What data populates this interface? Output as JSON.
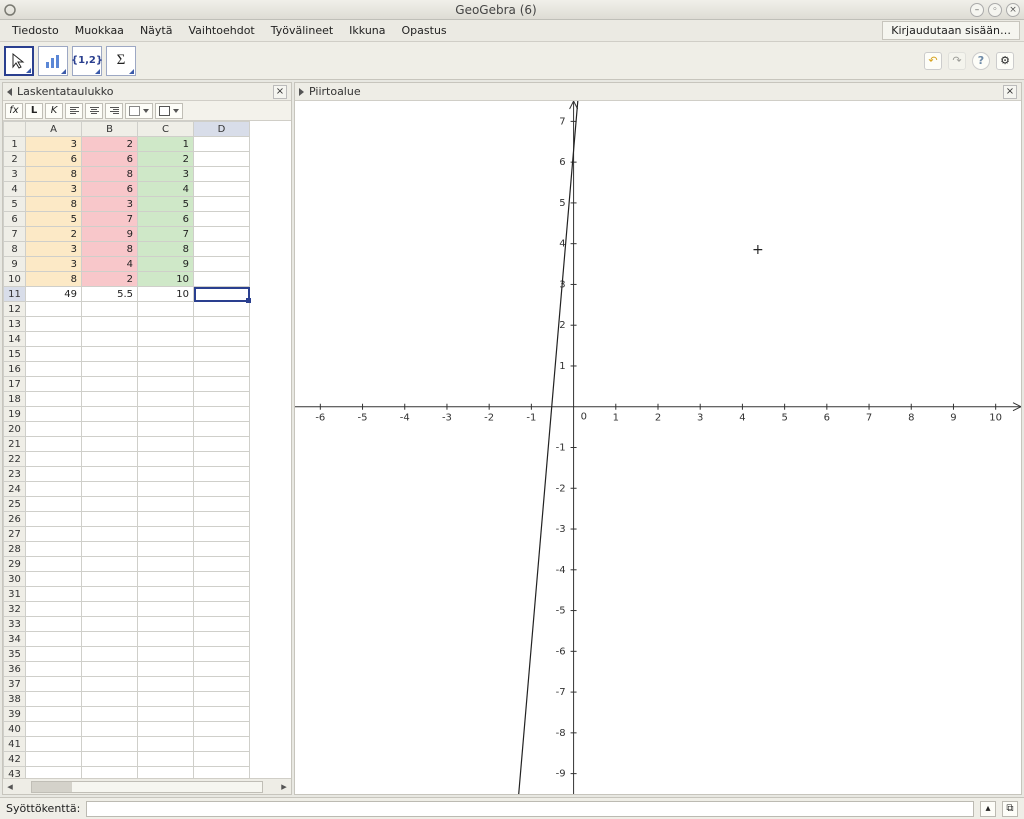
{
  "window": {
    "title": "GeoGebra (6)"
  },
  "menu": {
    "items": [
      "Tiedosto",
      "Muokkaa",
      "Näytä",
      "Vaihtoehdot",
      "Työvälineet",
      "Ikkuna",
      "Opastus"
    ],
    "login": "Kirjaudutaan sisään…"
  },
  "tools": {
    "names": [
      "move-tool",
      "analysis-tool",
      "list-tool",
      "sum-tool"
    ],
    "labels": [
      "↖",
      "📊",
      "{1,2}",
      "Σ"
    ]
  },
  "icons": {
    "undo": "↶",
    "redo": "↷",
    "help": "?",
    "settings": "⚙",
    "close": "×",
    "updown": "◂▸"
  },
  "panels": {
    "left_title": "Laskentataulukko",
    "right_title": "Piirtoalue"
  },
  "spreadsheet_toolbar": {
    "fx": "fx",
    "bold": "L",
    "italic": "K"
  },
  "spreadsheet": {
    "columns": [
      "A",
      "B",
      "C",
      "D"
    ],
    "selected_col_index": 3,
    "selected_cell": {
      "row": 11,
      "col": 3
    },
    "total_rows": 43,
    "data_rows": [
      {
        "A": "3",
        "B": "2",
        "C": "1",
        "D": ""
      },
      {
        "A": "6",
        "B": "6",
        "C": "2",
        "D": ""
      },
      {
        "A": "8",
        "B": "8",
        "C": "3",
        "D": ""
      },
      {
        "A": "3",
        "B": "6",
        "C": "4",
        "D": ""
      },
      {
        "A": "8",
        "B": "3",
        "C": "5",
        "D": ""
      },
      {
        "A": "5",
        "B": "7",
        "C": "6",
        "D": ""
      },
      {
        "A": "2",
        "B": "9",
        "C": "7",
        "D": ""
      },
      {
        "A": "3",
        "B": "8",
        "C": "8",
        "D": ""
      },
      {
        "A": "3",
        "B": "4",
        "C": "9",
        "D": ""
      },
      {
        "A": "8",
        "B": "2",
        "C": "10",
        "D": ""
      }
    ],
    "sum_row": {
      "A": "49",
      "B": "5.5",
      "C": "10",
      "D": ""
    }
  },
  "chart_data": {
    "type": "line",
    "xlabel": "",
    "ylabel": "",
    "xlim": [
      -6.6,
      10.6
    ],
    "ylim": [
      -9.5,
      7.5
    ],
    "xticks": [
      -6,
      -5,
      -4,
      -3,
      -2,
      -1,
      0,
      1,
      2,
      3,
      4,
      5,
      6,
      7,
      8,
      9,
      10
    ],
    "yticks": [
      -9,
      -8,
      -7,
      -6,
      -5,
      -4,
      -3,
      -2,
      -1,
      0,
      1,
      2,
      3,
      4,
      5,
      6,
      7
    ],
    "series": [
      {
        "name": "line",
        "points": [
          [
            -1.3,
            -9.5
          ],
          [
            0.1,
            7.5
          ]
        ]
      }
    ]
  },
  "inputbar": {
    "label": "Syöttökenttä:",
    "value": ""
  }
}
